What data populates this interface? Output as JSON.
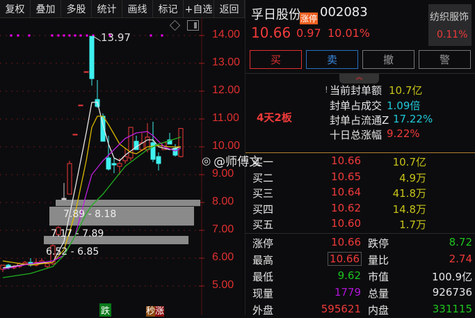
{
  "toolbar": [
    "复权",
    "叠加",
    "多股",
    "统计",
    "画线",
    "标记",
    "+自选",
    "返回"
  ],
  "axis_labels": [
    "14.00",
    "13.00",
    "12.00",
    "11.00",
    "10.00",
    "9.00",
    "8.00",
    "7.00",
    "6.00",
    "5.00"
  ],
  "axis_values": [
    14,
    13,
    12,
    11,
    10,
    9,
    8,
    7,
    6,
    5
  ],
  "peak_label": "13.97",
  "zones": [
    {
      "label": "7.89 - 8.18"
    },
    {
      "label": "7.17 - 7.89"
    },
    {
      "label": "6.52 - 6.85"
    }
  ],
  "bottom_tags": {
    "down": "跌",
    "fast_up_a": "秒",
    "fast_up_b": "涨"
  },
  "watermark": "@师傅文",
  "colors": {
    "up": "#f03a3a",
    "down": "#3ff0f0",
    "ma5": "#e8e8e8",
    "ma10": "#d8b800",
    "ma20": "#c020e0",
    "ma30": "#20b020"
  },
  "candles": [
    [
      5.6,
      5.75,
      5.5,
      5.75
    ],
    [
      5.75,
      5.8,
      5.6,
      5.65
    ],
    [
      5.65,
      5.75,
      5.6,
      5.7
    ],
    [
      5.7,
      5.85,
      5.65,
      5.8
    ],
    [
      5.8,
      5.9,
      5.75,
      5.85
    ],
    [
      5.85,
      6.0,
      5.7,
      5.75
    ],
    [
      5.75,
      6.0,
      5.7,
      5.85
    ],
    [
      5.85,
      6.0,
      5.8,
      5.9
    ],
    [
      5.7,
      5.85,
      5.65,
      5.8
    ],
    [
      5.8,
      6.5,
      5.75,
      6.45
    ],
    [
      6.85,
      7.15,
      6.8,
      7.1
    ],
    [
      8.15,
      8.7,
      8.1,
      8.1
    ],
    [
      8.3,
      9.5,
      8.3,
      9.4
    ],
    [
      10.45,
      10.45,
      10.45,
      10.45
    ],
    [
      11.5,
      11.5,
      11.5,
      11.5
    ],
    [
      12.7,
      12.7,
      12.7,
      12.7
    ],
    [
      13.97,
      13.97,
      12.2,
      12.45
    ],
    [
      11.7,
      12.4,
      11.4,
      11.45
    ],
    [
      11.1,
      11.2,
      10.2,
      10.2
    ],
    [
      9.6,
      10.4,
      9.15,
      9.2
    ],
    [
      9.4,
      9.6,
      9.05,
      9.35
    ],
    [
      9.3,
      9.6,
      9.0,
      9.4
    ],
    [
      9.5,
      9.95,
      9.4,
      9.65
    ],
    [
      9.6,
      10.7,
      9.5,
      10.7
    ],
    [
      10.2,
      10.4,
      9.9,
      9.9
    ],
    [
      9.9,
      10.5,
      9.85,
      10.15
    ],
    [
      9.9,
      10.85,
      9.8,
      10.35
    ],
    [
      10.15,
      10.9,
      9.45,
      9.55
    ],
    [
      9.65,
      9.8,
      9.15,
      9.4
    ],
    [
      9.9,
      10.15,
      9.9,
      10.15
    ],
    [
      10.25,
      10.5,
      10.1,
      10.1
    ],
    [
      9.95,
      10.1,
      9.65,
      9.7
    ],
    [
      9.65,
      10.66,
      9.62,
      10.66
    ]
  ],
  "ma5": [
    [
      0,
      5.65
    ],
    [
      5,
      5.8
    ],
    [
      9,
      5.85
    ],
    [
      11,
      6.6
    ],
    [
      13,
      8.5
    ],
    [
      15,
      10.5
    ],
    [
      16,
      11.6
    ],
    [
      17,
      11.6
    ],
    [
      18,
      10.8
    ],
    [
      19,
      10.1
    ],
    [
      20,
      9.6
    ],
    [
      21,
      9.5
    ],
    [
      22,
      9.7
    ],
    [
      24,
      10.0
    ],
    [
      26,
      10.25
    ],
    [
      27,
      10.25
    ],
    [
      28,
      10.0
    ],
    [
      30,
      9.9
    ],
    [
      32,
      10.0
    ]
  ],
  "ma10": [
    [
      0,
      5.9
    ],
    [
      5,
      5.75
    ],
    [
      9,
      5.85
    ],
    [
      11,
      6.3
    ],
    [
      13,
      7.6
    ],
    [
      15,
      9.5
    ],
    [
      16,
      10.7
    ],
    [
      17,
      11.1
    ],
    [
      18,
      11.1
    ],
    [
      19,
      10.8
    ],
    [
      21,
      10.1
    ],
    [
      23,
      9.8
    ],
    [
      24,
      9.75
    ],
    [
      26,
      10.0
    ],
    [
      28,
      10.05
    ],
    [
      30,
      10.0
    ],
    [
      32,
      10.0
    ]
  ],
  "ma20": [
    [
      0,
      5.6
    ],
    [
      5,
      5.8
    ],
    [
      9,
      5.9
    ],
    [
      11,
      6.1
    ],
    [
      13,
      6.8
    ],
    [
      15,
      8.3
    ],
    [
      16,
      9.0
    ],
    [
      18,
      9.5
    ],
    [
      20,
      9.9
    ],
    [
      22,
      10.3
    ],
    [
      24,
      10.5
    ],
    [
      26,
      10.55
    ],
    [
      27,
      10.4
    ],
    [
      29,
      10.0
    ],
    [
      31,
      9.85
    ],
    [
      32,
      9.95
    ]
  ],
  "ma30": [
    [
      0,
      5.3
    ],
    [
      5,
      5.45
    ],
    [
      9,
      5.7
    ],
    [
      11,
      6.1
    ],
    [
      13,
      6.8
    ],
    [
      15,
      7.6
    ],
    [
      16,
      7.9
    ],
    [
      18,
      8.3
    ],
    [
      20,
      8.8
    ],
    [
      22,
      9.3
    ],
    [
      24,
      9.6
    ],
    [
      26,
      9.9
    ],
    [
      28,
      10.1
    ],
    [
      32,
      10.35
    ]
  ],
  "stock": {
    "name": "孚日股份",
    "badge": "涨停",
    "code": "002083",
    "price": "10.66",
    "change": "0.97",
    "pct": "10.01%",
    "sector": "纺织服饰",
    "sector_pct": "0.11%"
  },
  "actions": {
    "buy": "买",
    "sell": "卖",
    "cancel": "撤",
    "alert": "警"
  },
  "streak": "4天2板",
  "info": [
    {
      "label": "当前封单额",
      "value": "10.7亿"
    },
    {
      "label": "封单占成交",
      "value": "1.09倍"
    },
    {
      "label": "封单占流通Z",
      "value": "17.22%"
    },
    {
      "label": "十日总涨幅",
      "value": "9.22%"
    }
  ],
  "bids": [
    {
      "label": "买一",
      "price": "10.66",
      "vol": "10.7亿"
    },
    {
      "label": "买二",
      "price": "10.65",
      "vol": "4.9万"
    },
    {
      "label": "买三",
      "price": "10.64",
      "vol": "41.8万"
    },
    {
      "label": "买四",
      "price": "10.62",
      "vol": "14.8万"
    },
    {
      "label": "买五",
      "price": "10.60",
      "vol": "1.7万"
    }
  ],
  "stats": [
    {
      "l1": "涨停",
      "v1": "10.66",
      "l2": "跌停",
      "v2": "8.72"
    },
    {
      "l1": "最高",
      "v1": "10.66",
      "l2": "量比",
      "v2": "2.74"
    },
    {
      "l1": "最低",
      "v1": "9.62",
      "l2": "市值",
      "v2": "100.9亿"
    },
    {
      "l1": "现量",
      "v1": "1779",
      "l2": "总量",
      "v2": "926736"
    },
    {
      "l1": "外盘",
      "v1": "595621",
      "l2": "内盘",
      "v2": "331115"
    }
  ]
}
